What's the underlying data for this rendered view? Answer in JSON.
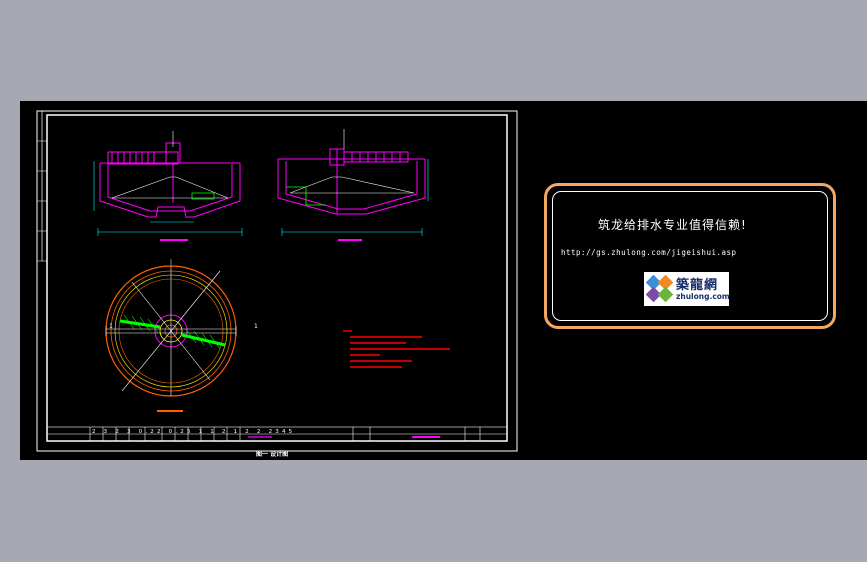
{
  "viewport": {
    "background": "#000000",
    "app_background": "#a6a9b1"
  },
  "drawing": {
    "title_block_row": [
      "2",
      "3",
      "2",
      "3",
      "0.22",
      "0.25",
      "1",
      "1",
      "2",
      "1",
      "2",
      "2",
      "2345"
    ],
    "caption": "图一 设计图",
    "plan_marks": [
      "1",
      "1"
    ],
    "colors": {
      "frame": "#ffffff",
      "structure": "#ff00ff",
      "dimension": "#00ffff",
      "ring_outer": "#ff6000",
      "ring_inner": "#ffff00",
      "notes": "#ff0000",
      "scrapers": "#00ff00"
    }
  },
  "panel": {
    "slogan": "筑龙给排水专业值得信赖!",
    "url": "http://gs.zhulong.com/jigeishui.asp",
    "logo_cn": "築龍網",
    "logo_en": "zhulong.com",
    "border_color": "#f2a860"
  }
}
